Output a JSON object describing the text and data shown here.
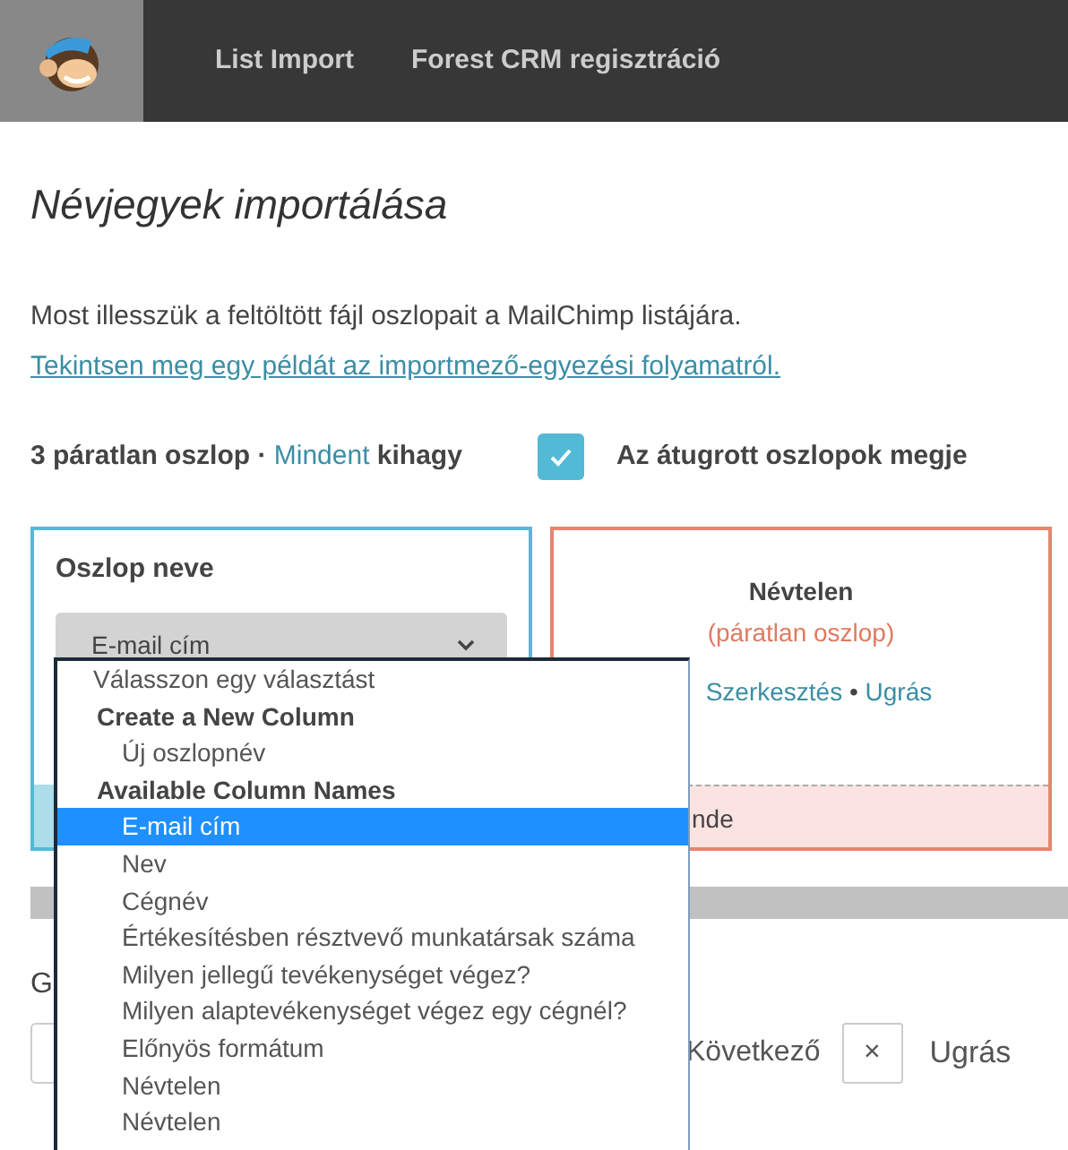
{
  "header": {
    "nav": [
      {
        "label": "List Import"
      },
      {
        "label": "Forest CRM regisztráció"
      }
    ]
  },
  "title": "Névjegyek importálása",
  "intro": "Most illesszük a feltöltött fájl oszlopait a MailChimp listájára.",
  "example_link": "Tekintsen meg egy példát az importmező-egyezési folyamatról.",
  "summary": {
    "count_text": "3 páratlan oszlop ·",
    "skip_all_link": "Mindent",
    "skip_text": "kihagy"
  },
  "show_skipped": {
    "label": "Az átugrott oszlopok megje",
    "checked": true
  },
  "columns": [
    {
      "kind": "editing",
      "label": "Oszlop neve",
      "select_value": "E-mail cím"
    },
    {
      "kind": "unmatched",
      "name": "Névtelen",
      "status": "(páratlan oszlop)",
      "edit_link": "Szerkesztés",
      "separator": "•",
      "skip_link": "Ugrás",
      "footer": "nde"
    }
  ],
  "bottom": {
    "label": "G",
    "next_button": "Következő",
    "skip_icon": "×",
    "skip_label": "Ugrás"
  },
  "dropdown": {
    "items": [
      {
        "kind": "option",
        "label": "Válasszon egy választást",
        "selected": false
      },
      {
        "kind": "group",
        "label": "Create a New Column",
        "children": [
          {
            "label": "Új oszlopnév",
            "selected": false
          }
        ]
      },
      {
        "kind": "group",
        "label": "Available Column Names",
        "children": [
          {
            "label": "E-mail cím",
            "selected": true
          },
          {
            "label": "Nev",
            "selected": false
          },
          {
            "label": "Cégnév",
            "selected": false
          },
          {
            "label": "Értékesítésben résztvevő munkatársak száma",
            "selected": false
          },
          {
            "label": "Milyen jellegű tevékenységet végez?",
            "selected": false
          },
          {
            "label": "Milyen alaptevékenységet végez egy cégnél?",
            "selected": false
          },
          {
            "label": "Előnyös formátum",
            "selected": false
          },
          {
            "label": "Névtelen",
            "selected": false
          },
          {
            "label": "Névtelen",
            "selected": false
          }
        ]
      }
    ]
  }
}
